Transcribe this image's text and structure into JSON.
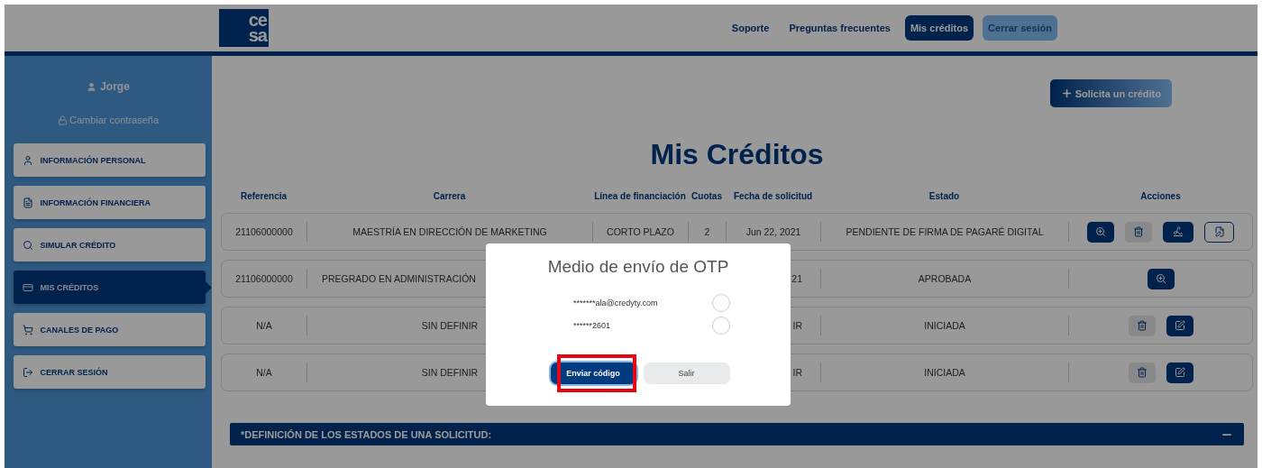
{
  "header": {
    "logo": [
      "ce",
      "sa"
    ],
    "nav": [
      {
        "label": "Soporte",
        "kind": "link",
        "selected": false
      },
      {
        "label": "Preguntas frecuentes",
        "kind": "link",
        "selected": false
      },
      {
        "label": "Mis créditos",
        "kind": "button",
        "selected": true
      },
      {
        "label": "Cerrar sesión",
        "kind": "button",
        "selected": false
      }
    ]
  },
  "sidebar": {
    "user": "Jorge",
    "change_password": "Cambiar contraseña",
    "items": [
      {
        "label": "INFORMACIÓN PERSONAL",
        "selected": false
      },
      {
        "label": "INFORMACIÓN FINANCIERA",
        "selected": false
      },
      {
        "label": "SIMULAR CRÉDITO",
        "selected": false
      },
      {
        "label": "MIS CRÉDITOS",
        "selected": true
      },
      {
        "label": "CANALES DE PAGO",
        "selected": false
      },
      {
        "label": "CERRAR SESIÓN",
        "selected": false
      }
    ]
  },
  "new_credit_button": "Solicita un crédito",
  "title": "Mis Créditos",
  "table": {
    "columns": [
      "Referencia",
      "Carrera",
      "Línea de financiación",
      "Cuotas",
      "Fecha de solicitud",
      "Estado",
      "Acciones"
    ],
    "rows": [
      {
        "cells": [
          {
            "text": "21106000000"
          },
          {
            "text": "MAESTRÍA EN DIRECCIÓN DE MARKETING"
          },
          {
            "text": "CORTO PLAZO"
          },
          {
            "text": "2"
          },
          {
            "text": "Jun 22, 2021"
          },
          {
            "text": "PENDIENTE DE FIRMA DE PAGARÉ DIGITAL"
          }
        ],
        "actions": [
          {
            "kind": "view"
          },
          {
            "kind": "delete"
          },
          {
            "kind": "sign"
          },
          {
            "kind": "document"
          }
        ]
      },
      {
        "cells": [
          {
            "text": "21106000000"
          },
          {
            "text": "PREGRADO EN ADMINISTRACIÓN",
            "cut_end": true
          },
          {
            "text": "21",
            "cut_start": true
          },
          {
            "text": "APROBADA"
          }
        ],
        "actions": [
          {
            "kind": "view"
          }
        ]
      },
      {
        "cells": [
          {
            "text": "N/A"
          },
          {
            "text": "SIN DEFINIR"
          },
          {
            "text": "IR",
            "cut_start": true
          },
          {
            "text": "INICIADA"
          }
        ],
        "actions": [
          {
            "kind": "delete"
          },
          {
            "kind": "edit"
          }
        ]
      },
      {
        "cells": [
          {
            "text": "N/A"
          },
          {
            "text": "SIN DEFINIR"
          },
          {
            "text": "IR",
            "cut_start": true
          },
          {
            "text": "INICIADA"
          }
        ],
        "actions": [
          {
            "kind": "delete"
          },
          {
            "kind": "edit"
          }
        ]
      }
    ]
  },
  "states_panel": {
    "title": "*DEFINICIÓN DE LOS ESTADOS DE UNA SOLICITUD:"
  },
  "modal": {
    "title": "Medio de envío de OTP",
    "options": [
      {
        "label": "*******ala@credyty.com",
        "selected": false
      },
      {
        "label": "******2601",
        "selected": false
      }
    ],
    "buttons": [
      {
        "label": "Enviar código",
        "kind": "primary",
        "highlighted": true
      },
      {
        "label": "Salir",
        "kind": "secondary",
        "highlighted": false
      }
    ]
  }
}
